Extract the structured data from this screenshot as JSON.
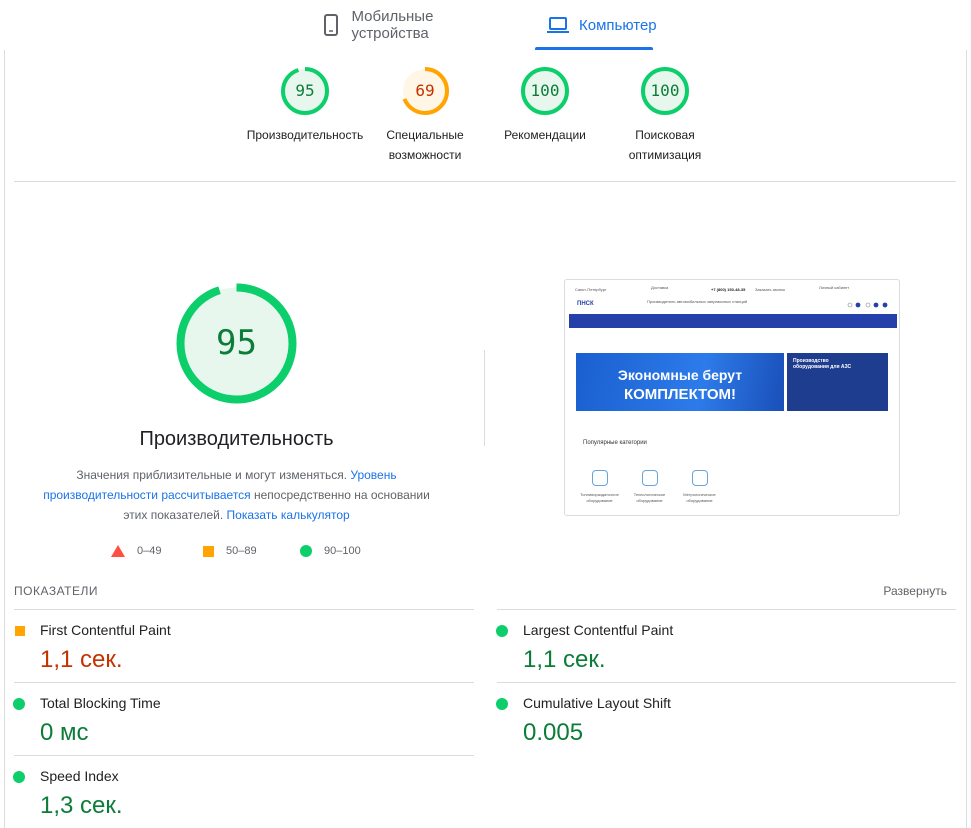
{
  "tabs": [
    {
      "label": "Мобильные устройства",
      "icon": "phone-icon",
      "active": false
    },
    {
      "label": "Компьютер",
      "icon": "laptop-icon",
      "active": true
    }
  ],
  "categories": [
    {
      "score": 95,
      "label_lines": [
        "Производительность"
      ],
      "rating": "good"
    },
    {
      "score": 69,
      "label_lines": [
        "Специальные",
        "возможности"
      ],
      "rating": "average"
    },
    {
      "score": 100,
      "label_lines": [
        "Рекомендации"
      ],
      "rating": "good"
    },
    {
      "score": 100,
      "label_lines": [
        "Поисковая",
        "оптимизация"
      ],
      "rating": "good"
    }
  ],
  "performance": {
    "score": 95,
    "title": "Производительность",
    "desc_1": "Значения приблизительные и могут изменяться. ",
    "desc_link_1": "Уровень производительности рассчитывается",
    "desc_2": " непосредственно на основании этих показателей. ",
    "desc_link_2": "Показать калькулятор"
  },
  "legend": [
    {
      "shape": "triangle",
      "range": "0–49",
      "color": "#ff4e42"
    },
    {
      "shape": "square",
      "range": "50–89",
      "color": "#ffa400"
    },
    {
      "shape": "circle",
      "range": "90–100",
      "color": "#0cce6b"
    }
  ],
  "thumbnail": {
    "city": "Санкт-Петербург",
    "delivery": "Доставка",
    "phone": "+7 (800) 150-48-35",
    "callback": "Заказать звонок",
    "cabinet": "Личный кабинет",
    "logo": "ПНСК",
    "tagline": "Производитель автомобильных заправочных станций",
    "banner_line_1": "Экономные берут",
    "banner_line_2": "КОМПЛЕКТОМ!",
    "promo": "Производство оборудования для АЗС",
    "popular": "Популярные категории",
    "cat_labels": [
      "Топливораздаточное оборудование",
      "Технологическое оборудование",
      "Метрологическое оборудование"
    ]
  },
  "metrics_header": "ПОКАЗАТЕЛИ",
  "expand_label": "Развернуть",
  "metrics": [
    {
      "name": "First Contentful Paint",
      "value": "1,1 сек.",
      "rating": "average"
    },
    {
      "name": "Largest Contentful Paint",
      "value": "1,1 сек.",
      "rating": "good"
    },
    {
      "name": "Total Blocking Time",
      "value": "0 мс",
      "rating": "good"
    },
    {
      "name": "Cumulative Layout Shift",
      "value": "0.005",
      "rating": "good"
    },
    {
      "name": "Speed Index",
      "value": "1,3 сек.",
      "rating": "good"
    }
  ],
  "colors": {
    "accent": "#1a73e8",
    "good": "#0cce6b",
    "average": "#ffa400",
    "good_text": "#0c7d38",
    "average_text": "#c33300"
  }
}
